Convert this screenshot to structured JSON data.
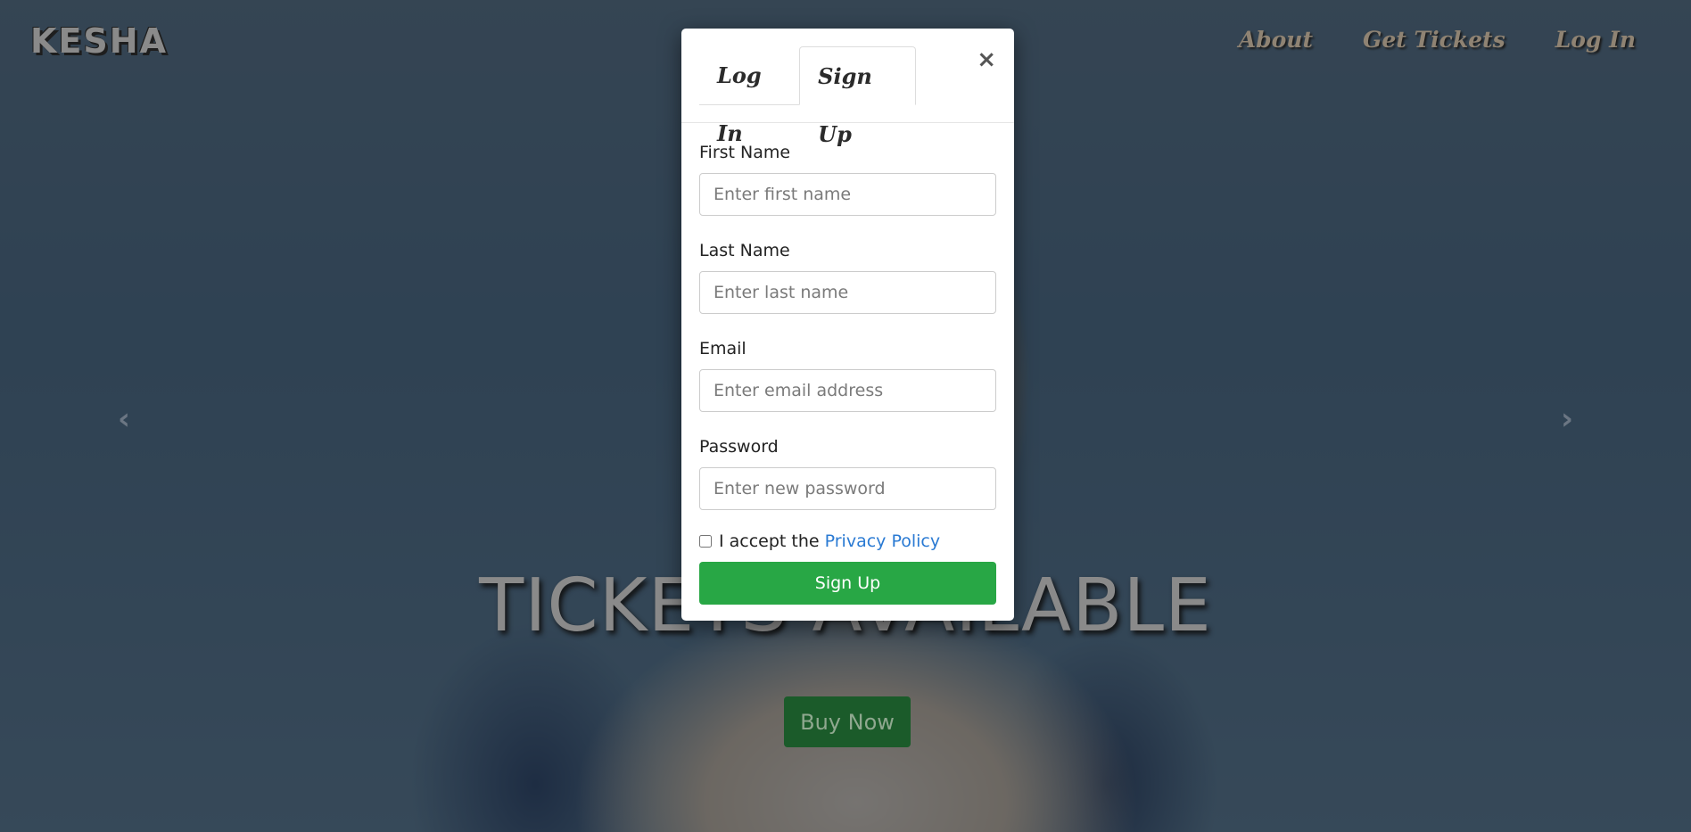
{
  "brand": "KESHA",
  "nav": {
    "items": [
      {
        "label": "About"
      },
      {
        "label": "Get Tickets"
      },
      {
        "label": "Log In"
      }
    ]
  },
  "carousel": {
    "prev_glyph": "‹",
    "next_glyph": "›",
    "headline": "TICKETS AVAILABLE",
    "cta_label": "Buy Now"
  },
  "modal": {
    "tabs": [
      {
        "label": "Log In",
        "active": false
      },
      {
        "label": "Sign Up",
        "active": true
      }
    ],
    "close_glyph": "×",
    "fields": {
      "first_name": {
        "label": "First Name",
        "placeholder": "Enter first name",
        "value": ""
      },
      "last_name": {
        "label": "Last Name",
        "placeholder": "Enter last name",
        "value": ""
      },
      "email": {
        "label": "Email",
        "placeholder": "Enter email address",
        "value": ""
      },
      "password": {
        "label": "Password",
        "placeholder": "Enter new password",
        "value": ""
      }
    },
    "policy": {
      "prefix": "I accept the",
      "link": "Privacy Policy",
      "checked": false
    },
    "submit_label": "Sign Up"
  },
  "colors": {
    "submit": "#28a745",
    "link": "#2a7ad3",
    "cta": "#1b5b2a"
  }
}
